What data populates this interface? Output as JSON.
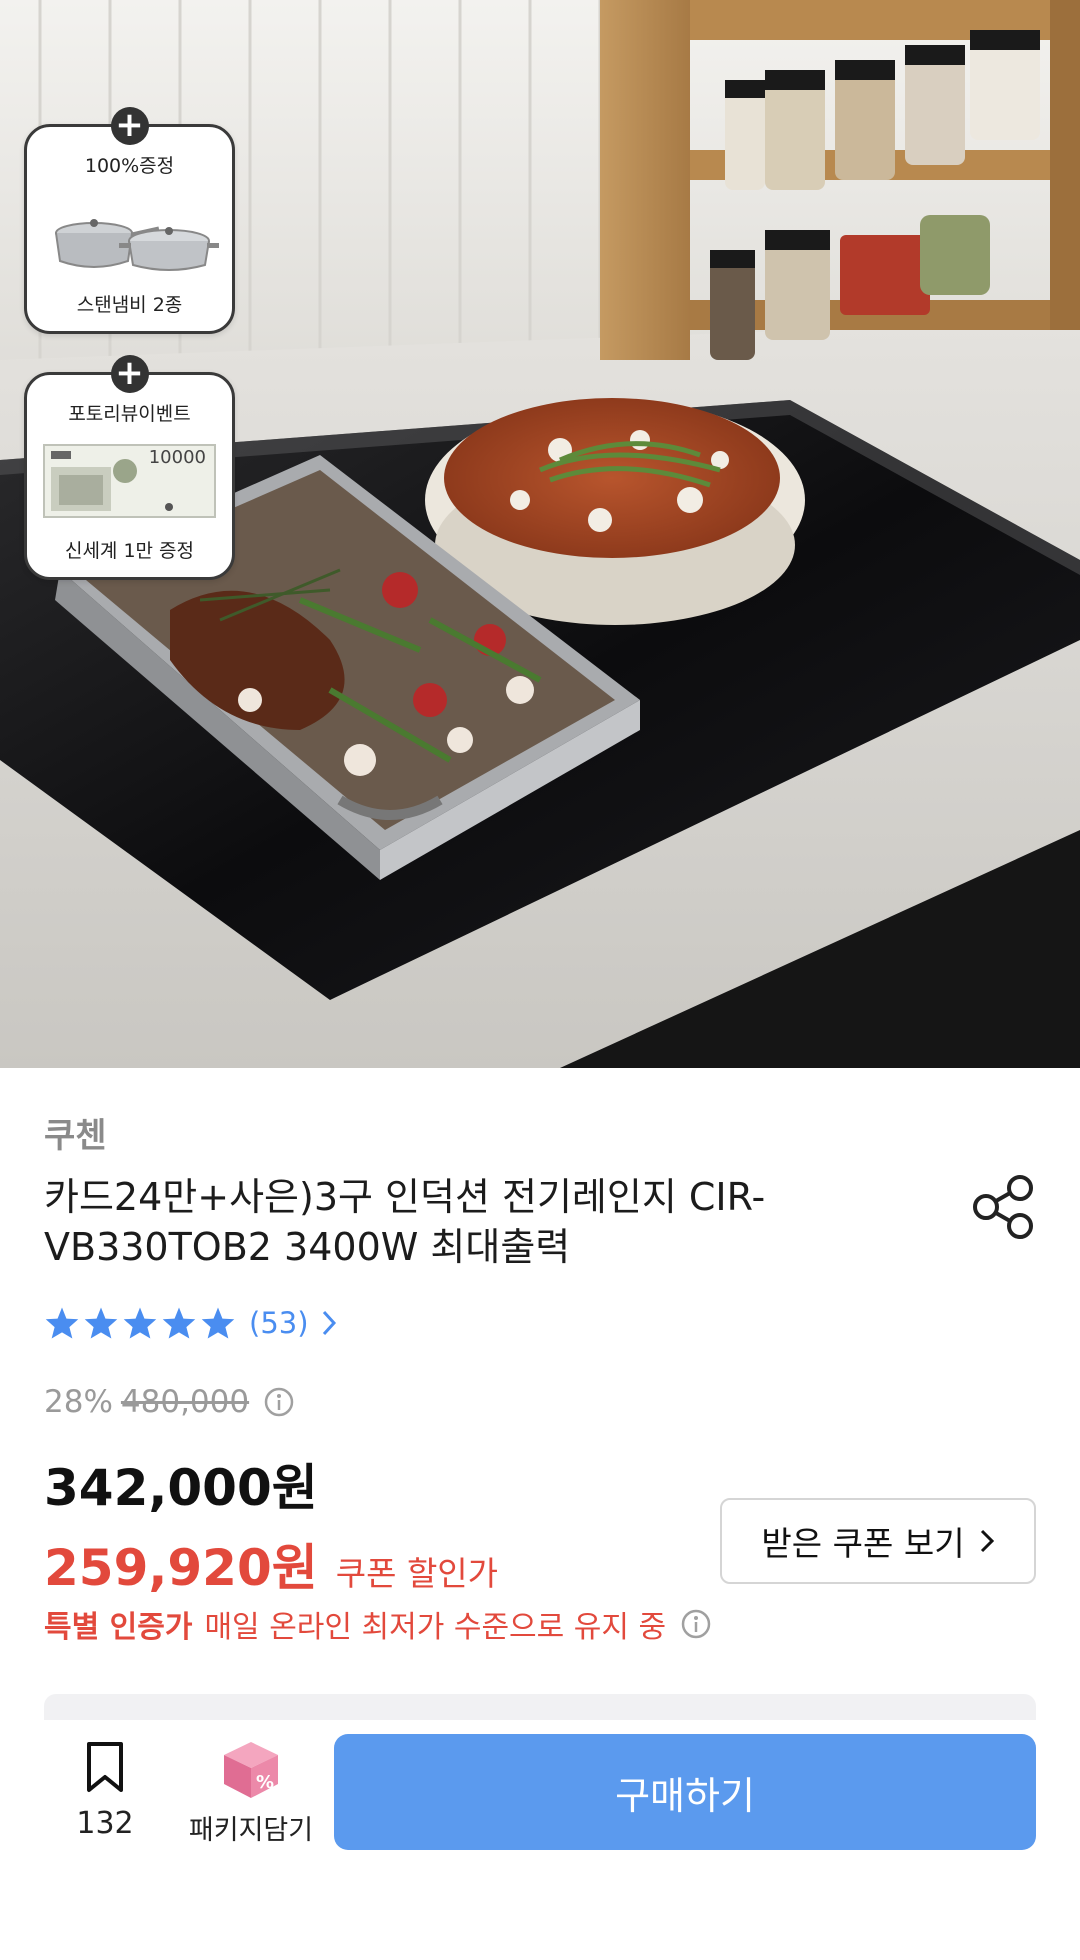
{
  "gifts": [
    {
      "top_label": "100%증정",
      "bottom_label": "스탠냄비 2종"
    },
    {
      "top_label": "포토리뷰이벤트",
      "bottom_label": "신세계 1만 증정",
      "voucher_value": "10000"
    }
  ],
  "product": {
    "brand": "쿠첸",
    "title": "카드24만+사은)3구 인덕션 전기레인지 CIR-VB330TOB2 3400W 최대출력",
    "rating": {
      "stars": 5,
      "count_text": "(53)"
    },
    "discount_percent": "28%",
    "original_price": "480,000",
    "price": "342,000원",
    "coupon_price": "259,920원",
    "coupon_price_label": "쿠폰 할인가",
    "coupon_button_label": "받은 쿠폰 보기",
    "special_tag": "특별 인증가",
    "special_desc": "매일 온라인 최저가 수준으로 유지 중"
  },
  "bottom_bar": {
    "bookmark_count": "132",
    "package_label": "패키지담기",
    "buy_label": "구매하기"
  },
  "colors": {
    "accent_red": "#e2493c",
    "accent_blue": "#5b9aee",
    "star_blue": "#4a8df0"
  },
  "icons": [
    "plus-icon",
    "share-icon",
    "star-icon",
    "chevron-right-icon",
    "info-icon",
    "bookmark-icon",
    "package-box-icon"
  ]
}
